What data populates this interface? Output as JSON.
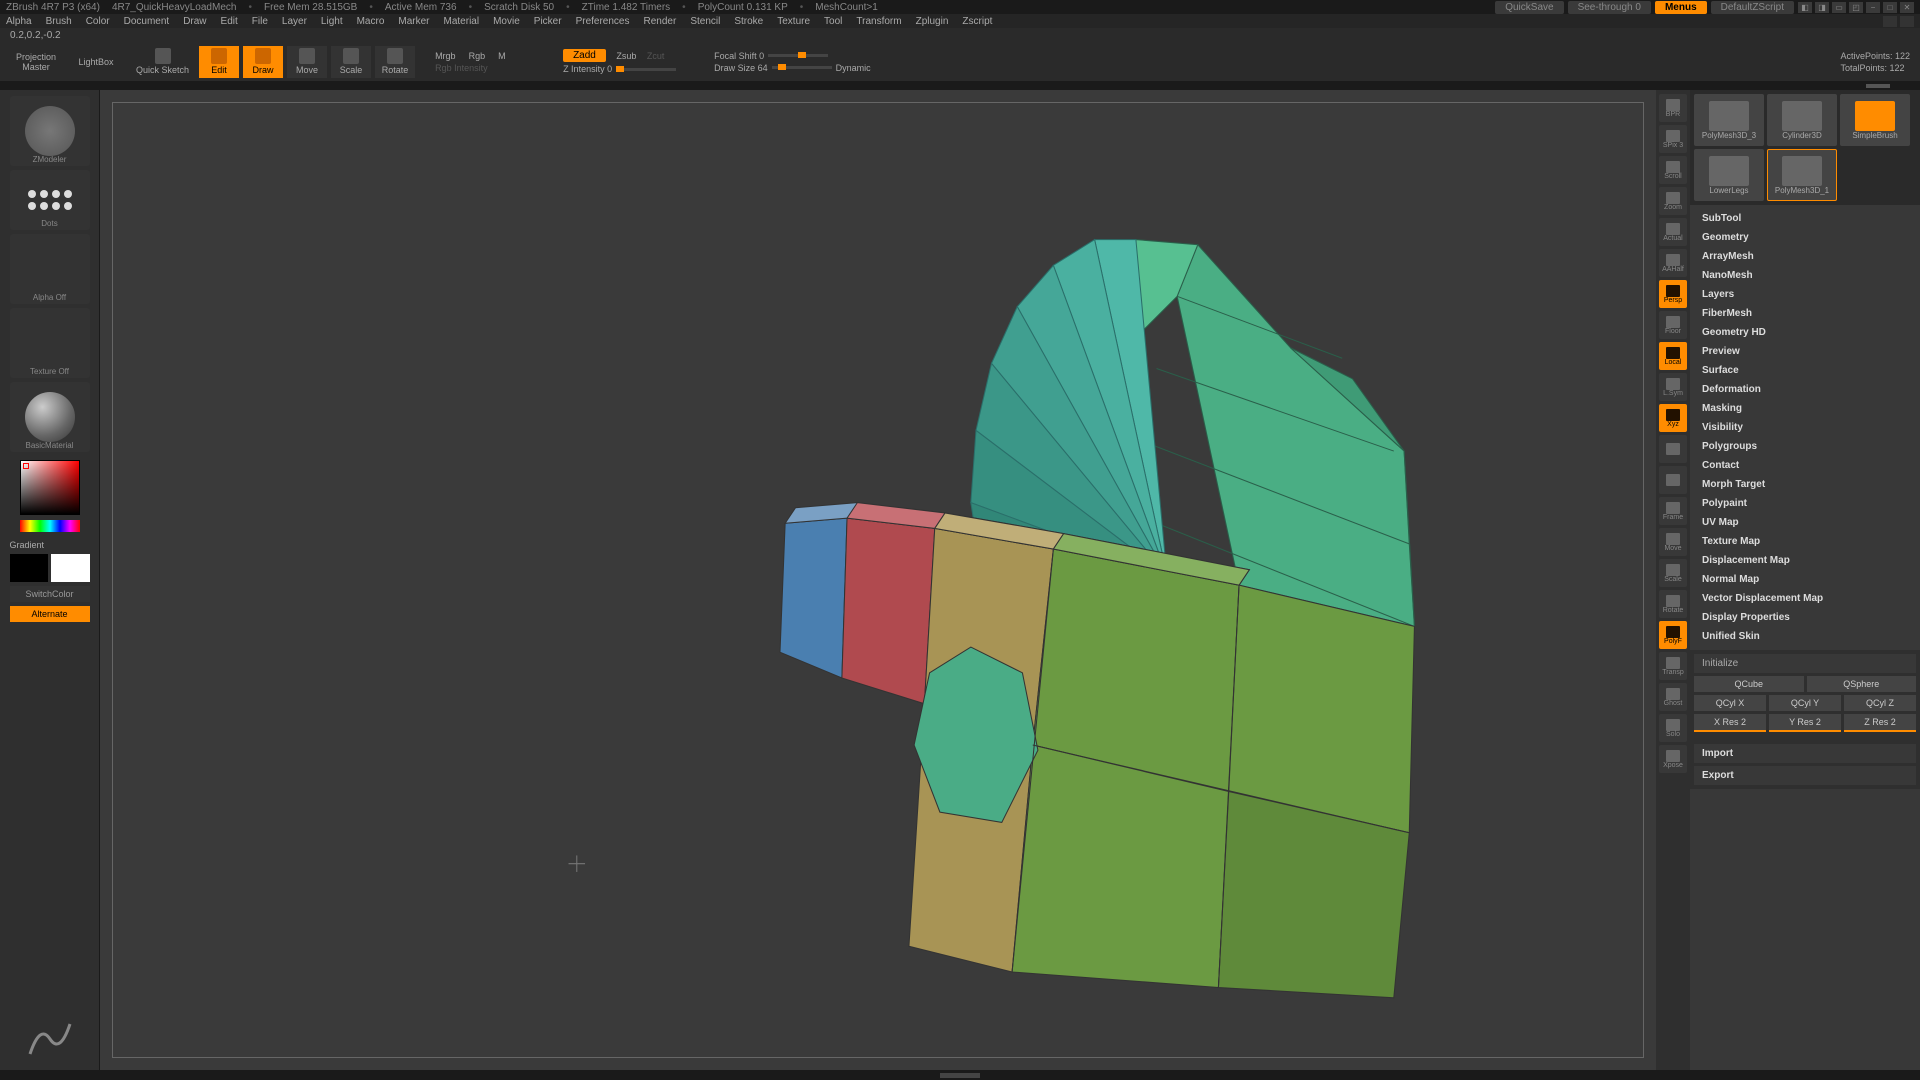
{
  "title": {
    "app": "ZBrush 4R7 P3 (x64)",
    "doc": "4R7_QuickHeavyLoadMech",
    "mem": "Free Mem 28.515GB",
    "activemem": "Active Mem 736",
    "scratch": "Scratch Disk 50",
    "ztime": "ZTime 1.482 Timers",
    "poly": "PolyCount 0.131 KP",
    "mesh": "MeshCount>1"
  },
  "titlebtns": {
    "quicksave": "QuickSave",
    "seethrough": "See-through   0",
    "menus": "Menus",
    "script": "DefaultZScript"
  },
  "menus": [
    "Alpha",
    "Brush",
    "Color",
    "Document",
    "Draw",
    "Edit",
    "File",
    "Layer",
    "Light",
    "Macro",
    "Marker",
    "Material",
    "Movie",
    "Picker",
    "Preferences",
    "Render",
    "Stencil",
    "Stroke",
    "Texture",
    "Tool",
    "Transform",
    "Zplugin",
    "Zscript"
  ],
  "status": "0.2,0.2,-0.2",
  "toolbar": {
    "proj1": "Projection",
    "proj2": "Master",
    "lightbox": "LightBox",
    "quicksketch": "Quick Sketch",
    "edit": "Edit",
    "draw": "Draw",
    "move": "Move",
    "scale": "Scale",
    "rotate": "Rotate",
    "mrgb": "Mrgb",
    "rgb": "Rgb",
    "m": "M",
    "rgbint": "Rgb Intensity",
    "zadd": "Zadd",
    "zsub": "Zsub",
    "zcut": "Zcut",
    "zint": "Z Intensity 0",
    "focal": "Focal Shift 0",
    "drawsize": "Draw Size 64",
    "dynamic": "Dynamic",
    "active": "ActivePoints: 122",
    "total": "TotalPoints: 122"
  },
  "left": {
    "zmodeler": "ZModeler",
    "dots": "Dots",
    "alpha": "Alpha Off",
    "texture": "Texture Off",
    "material": "BasicMaterial",
    "gradient": "Gradient",
    "switch": "SwitchColor",
    "alternate": "Alternate"
  },
  "rstrip": [
    {
      "l": "BPR",
      "a": false
    },
    {
      "l": "SPix 3",
      "a": false
    },
    {
      "l": "Scroll",
      "a": false
    },
    {
      "l": "Zoom",
      "a": false
    },
    {
      "l": "Actual",
      "a": false
    },
    {
      "l": "AAHalf",
      "a": false
    },
    {
      "l": "Persp",
      "a": true
    },
    {
      "l": "Floor",
      "a": false
    },
    {
      "l": "Local",
      "a": true
    },
    {
      "l": "L.Sym",
      "a": false
    },
    {
      "l": "Xyz",
      "a": true
    },
    {
      "l": "",
      "a": false
    },
    {
      "l": "",
      "a": false
    },
    {
      "l": "Frame",
      "a": false
    },
    {
      "l": "Move",
      "a": false
    },
    {
      "l": "Scale",
      "a": false
    },
    {
      "l": "Rotate",
      "a": false
    },
    {
      "l": "PolyF",
      "a": true
    },
    {
      "l": "Transp",
      "a": false
    },
    {
      "l": "Ghost",
      "a": false
    },
    {
      "l": "Solo",
      "a": false
    },
    {
      "l": "Xpose",
      "a": false
    }
  ],
  "toolslots": [
    {
      "n": "PolyMesh3D_3",
      "sel": false
    },
    {
      "n": "Cylinder3D",
      "sel": false
    },
    {
      "n": "SimpleBrush",
      "sel": false,
      "o": true
    },
    {
      "n": "LowerLegs",
      "sel": false
    },
    {
      "n": "PolyMesh3D_1",
      "sel": true
    }
  ],
  "palette": [
    "SubTool",
    "Geometry",
    "ArrayMesh",
    "NanoMesh",
    "Layers",
    "FiberMesh",
    "Geometry HD",
    "Preview",
    "Surface",
    "Deformation",
    "Masking",
    "Visibility",
    "Polygroups",
    "Contact",
    "Morph Target",
    "Polypaint",
    "UV Map",
    "Texture Map",
    "Displacement Map",
    "Normal Map",
    "Vector Displacement Map",
    "Display Properties",
    "Unified Skin"
  ],
  "init": {
    "title": "Initialize",
    "r1": [
      "QCube",
      "QSphere"
    ],
    "r2": [
      "QCyl X",
      "QCyl Y",
      "QCyl Z"
    ],
    "r3": [
      "X Res 2",
      "Y Res 2",
      "Z Res 2"
    ],
    "import": "Import",
    "export": "Export"
  }
}
